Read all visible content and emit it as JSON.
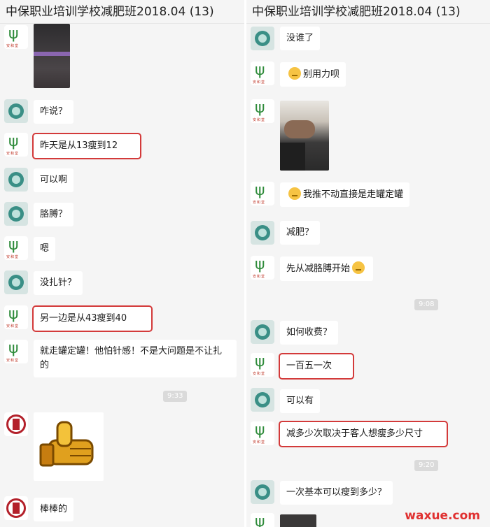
{
  "left": {
    "title": "中保职业培训学校减肥班2018.04 (13)",
    "messages": [
      {
        "text": "咋说？"
      },
      {
        "text": "昨天是从13瘦到12"
      },
      {
        "text": "可以啊"
      },
      {
        "text": "胳膊？"
      },
      {
        "text": "嗯"
      },
      {
        "text": "没扎针？"
      },
      {
        "text": "另一边是从43瘦到40"
      },
      {
        "text": "就走罐定罐！他怕针感！不是大问题是不让扎的"
      },
      {
        "text": "棒棒的"
      }
    ],
    "timestamp": "9:33"
  },
  "right": {
    "title": "中保职业培训学校减肥班2018.04 (13)",
    "messages": [
      {
        "text": "没谁了"
      },
      {
        "text": "别用力呗"
      },
      {
        "text": "我推不动直接是走罐定罐"
      },
      {
        "text": "减肥？"
      },
      {
        "text": "先从减胳膊开始"
      },
      {
        "text": "如何收费？"
      },
      {
        "text": "一百五一次"
      },
      {
        "text": "可以有"
      },
      {
        "text": "减多少次取决于客人想瘦多少尺寸"
      },
      {
        "text": "一次基本可以瘦到多少？"
      }
    ],
    "timestamps": [
      "9:08",
      "9:20"
    ]
  },
  "watermark": "waxue.com",
  "colors": {
    "highlight": "#d33a3a",
    "bubble": "#ffffff",
    "background": "#f5f5f5"
  }
}
